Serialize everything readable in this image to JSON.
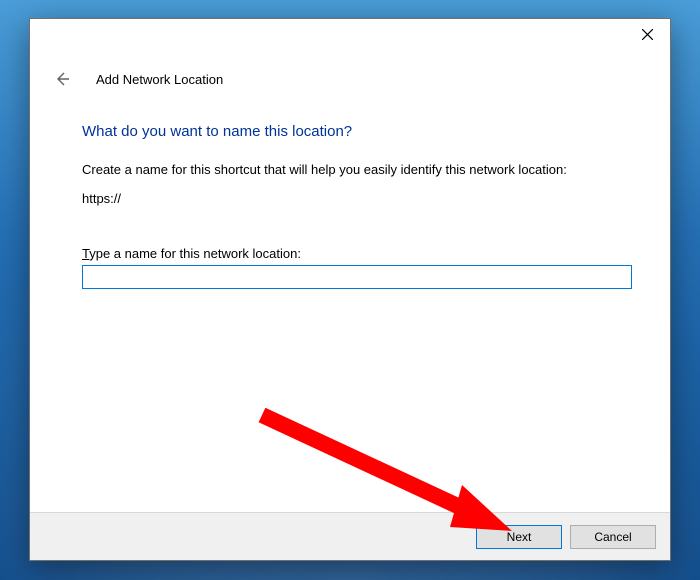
{
  "wizard": {
    "title": "Add Network Location",
    "heading": "What do you want to name this location?",
    "description": "Create a name for this shortcut that will help you easily identify this network location:",
    "url": "https://",
    "inputLabelPrefix": "T",
    "inputLabelRest": "ype a name for this network location:",
    "inputValue": ""
  },
  "buttons": {
    "next": "Next",
    "cancel": "Cancel"
  }
}
